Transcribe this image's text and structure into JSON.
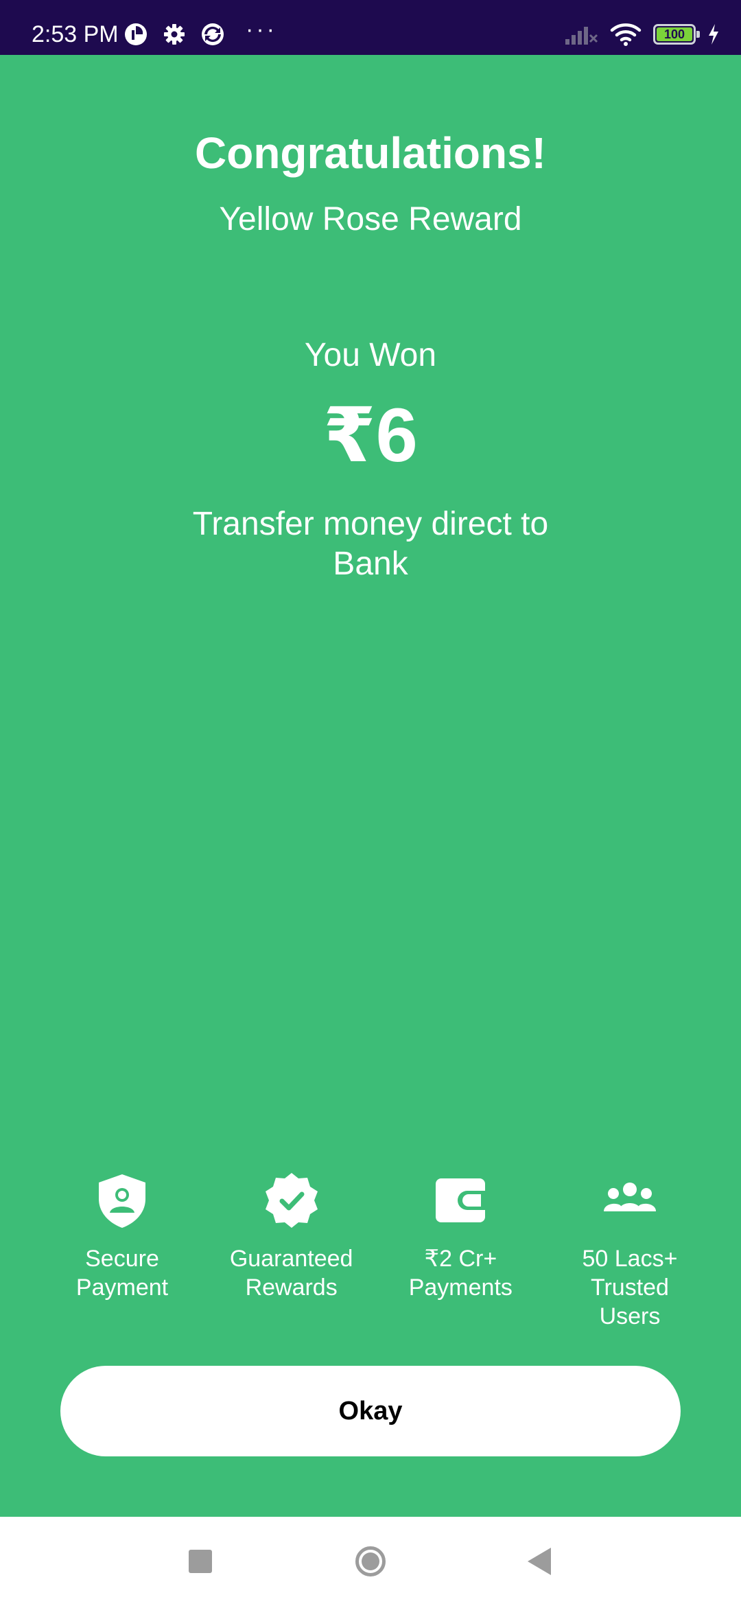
{
  "status_bar": {
    "time": "2:53 PM",
    "battery": "100",
    "left_icons": [
      "notification-icon",
      "gear-icon",
      "sync-icon"
    ],
    "right_icons": [
      "signal-icon",
      "wifi-icon",
      "battery-icon",
      "charging-icon"
    ],
    "more": "···"
  },
  "reward": {
    "title": "Congratulations!",
    "subtitle": "Yellow Rose Reward",
    "you_won": "You Won",
    "amount": "₹6",
    "transfer_text": "Transfer money direct to Bank"
  },
  "features": [
    {
      "icon": "shield-user-icon",
      "label": "Secure\nPayment"
    },
    {
      "icon": "verified-badge-icon",
      "label": "Guaranteed\nRewards"
    },
    {
      "icon": "wallet-icon",
      "label": "₹2 Cr+\nPayments"
    },
    {
      "icon": "users-group-icon",
      "label": "50 Lacs+\nTrusted\nUsers"
    }
  ],
  "okay_button": {
    "label": "Okay"
  },
  "nav_bar": {
    "icons": [
      "recent-apps-icon",
      "home-icon",
      "back-icon"
    ]
  },
  "colors": {
    "background": "#3dbd77",
    "status_bar": "#1e0a4f",
    "button_bg": "#ffffff",
    "nav_icon": "#9c9c9c"
  }
}
